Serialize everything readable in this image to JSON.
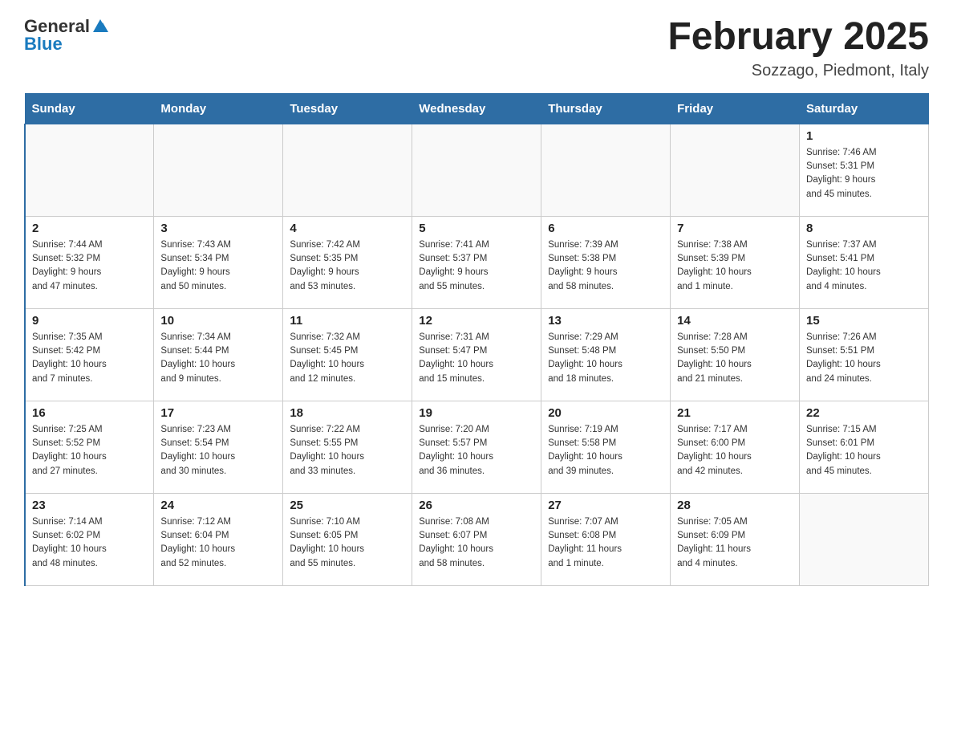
{
  "header": {
    "logo": {
      "text_general": "General",
      "text_blue": "Blue",
      "tagline": ""
    },
    "title": "February 2025",
    "location": "Sozzago, Piedmont, Italy"
  },
  "days_of_week": [
    "Sunday",
    "Monday",
    "Tuesday",
    "Wednesday",
    "Thursday",
    "Friday",
    "Saturday"
  ],
  "weeks": [
    [
      {
        "day": "",
        "info": ""
      },
      {
        "day": "",
        "info": ""
      },
      {
        "day": "",
        "info": ""
      },
      {
        "day": "",
        "info": ""
      },
      {
        "day": "",
        "info": ""
      },
      {
        "day": "",
        "info": ""
      },
      {
        "day": "1",
        "info": "Sunrise: 7:46 AM\nSunset: 5:31 PM\nDaylight: 9 hours\nand 45 minutes."
      }
    ],
    [
      {
        "day": "2",
        "info": "Sunrise: 7:44 AM\nSunset: 5:32 PM\nDaylight: 9 hours\nand 47 minutes."
      },
      {
        "day": "3",
        "info": "Sunrise: 7:43 AM\nSunset: 5:34 PM\nDaylight: 9 hours\nand 50 minutes."
      },
      {
        "day": "4",
        "info": "Sunrise: 7:42 AM\nSunset: 5:35 PM\nDaylight: 9 hours\nand 53 minutes."
      },
      {
        "day": "5",
        "info": "Sunrise: 7:41 AM\nSunset: 5:37 PM\nDaylight: 9 hours\nand 55 minutes."
      },
      {
        "day": "6",
        "info": "Sunrise: 7:39 AM\nSunset: 5:38 PM\nDaylight: 9 hours\nand 58 minutes."
      },
      {
        "day": "7",
        "info": "Sunrise: 7:38 AM\nSunset: 5:39 PM\nDaylight: 10 hours\nand 1 minute."
      },
      {
        "day": "8",
        "info": "Sunrise: 7:37 AM\nSunset: 5:41 PM\nDaylight: 10 hours\nand 4 minutes."
      }
    ],
    [
      {
        "day": "9",
        "info": "Sunrise: 7:35 AM\nSunset: 5:42 PM\nDaylight: 10 hours\nand 7 minutes."
      },
      {
        "day": "10",
        "info": "Sunrise: 7:34 AM\nSunset: 5:44 PM\nDaylight: 10 hours\nand 9 minutes."
      },
      {
        "day": "11",
        "info": "Sunrise: 7:32 AM\nSunset: 5:45 PM\nDaylight: 10 hours\nand 12 minutes."
      },
      {
        "day": "12",
        "info": "Sunrise: 7:31 AM\nSunset: 5:47 PM\nDaylight: 10 hours\nand 15 minutes."
      },
      {
        "day": "13",
        "info": "Sunrise: 7:29 AM\nSunset: 5:48 PM\nDaylight: 10 hours\nand 18 minutes."
      },
      {
        "day": "14",
        "info": "Sunrise: 7:28 AM\nSunset: 5:50 PM\nDaylight: 10 hours\nand 21 minutes."
      },
      {
        "day": "15",
        "info": "Sunrise: 7:26 AM\nSunset: 5:51 PM\nDaylight: 10 hours\nand 24 minutes."
      }
    ],
    [
      {
        "day": "16",
        "info": "Sunrise: 7:25 AM\nSunset: 5:52 PM\nDaylight: 10 hours\nand 27 minutes."
      },
      {
        "day": "17",
        "info": "Sunrise: 7:23 AM\nSunset: 5:54 PM\nDaylight: 10 hours\nand 30 minutes."
      },
      {
        "day": "18",
        "info": "Sunrise: 7:22 AM\nSunset: 5:55 PM\nDaylight: 10 hours\nand 33 minutes."
      },
      {
        "day": "19",
        "info": "Sunrise: 7:20 AM\nSunset: 5:57 PM\nDaylight: 10 hours\nand 36 minutes."
      },
      {
        "day": "20",
        "info": "Sunrise: 7:19 AM\nSunset: 5:58 PM\nDaylight: 10 hours\nand 39 minutes."
      },
      {
        "day": "21",
        "info": "Sunrise: 7:17 AM\nSunset: 6:00 PM\nDaylight: 10 hours\nand 42 minutes."
      },
      {
        "day": "22",
        "info": "Sunrise: 7:15 AM\nSunset: 6:01 PM\nDaylight: 10 hours\nand 45 minutes."
      }
    ],
    [
      {
        "day": "23",
        "info": "Sunrise: 7:14 AM\nSunset: 6:02 PM\nDaylight: 10 hours\nand 48 minutes."
      },
      {
        "day": "24",
        "info": "Sunrise: 7:12 AM\nSunset: 6:04 PM\nDaylight: 10 hours\nand 52 minutes."
      },
      {
        "day": "25",
        "info": "Sunrise: 7:10 AM\nSunset: 6:05 PM\nDaylight: 10 hours\nand 55 minutes."
      },
      {
        "day": "26",
        "info": "Sunrise: 7:08 AM\nSunset: 6:07 PM\nDaylight: 10 hours\nand 58 minutes."
      },
      {
        "day": "27",
        "info": "Sunrise: 7:07 AM\nSunset: 6:08 PM\nDaylight: 11 hours\nand 1 minute."
      },
      {
        "day": "28",
        "info": "Sunrise: 7:05 AM\nSunset: 6:09 PM\nDaylight: 11 hours\nand 4 minutes."
      },
      {
        "day": "",
        "info": ""
      }
    ]
  ]
}
